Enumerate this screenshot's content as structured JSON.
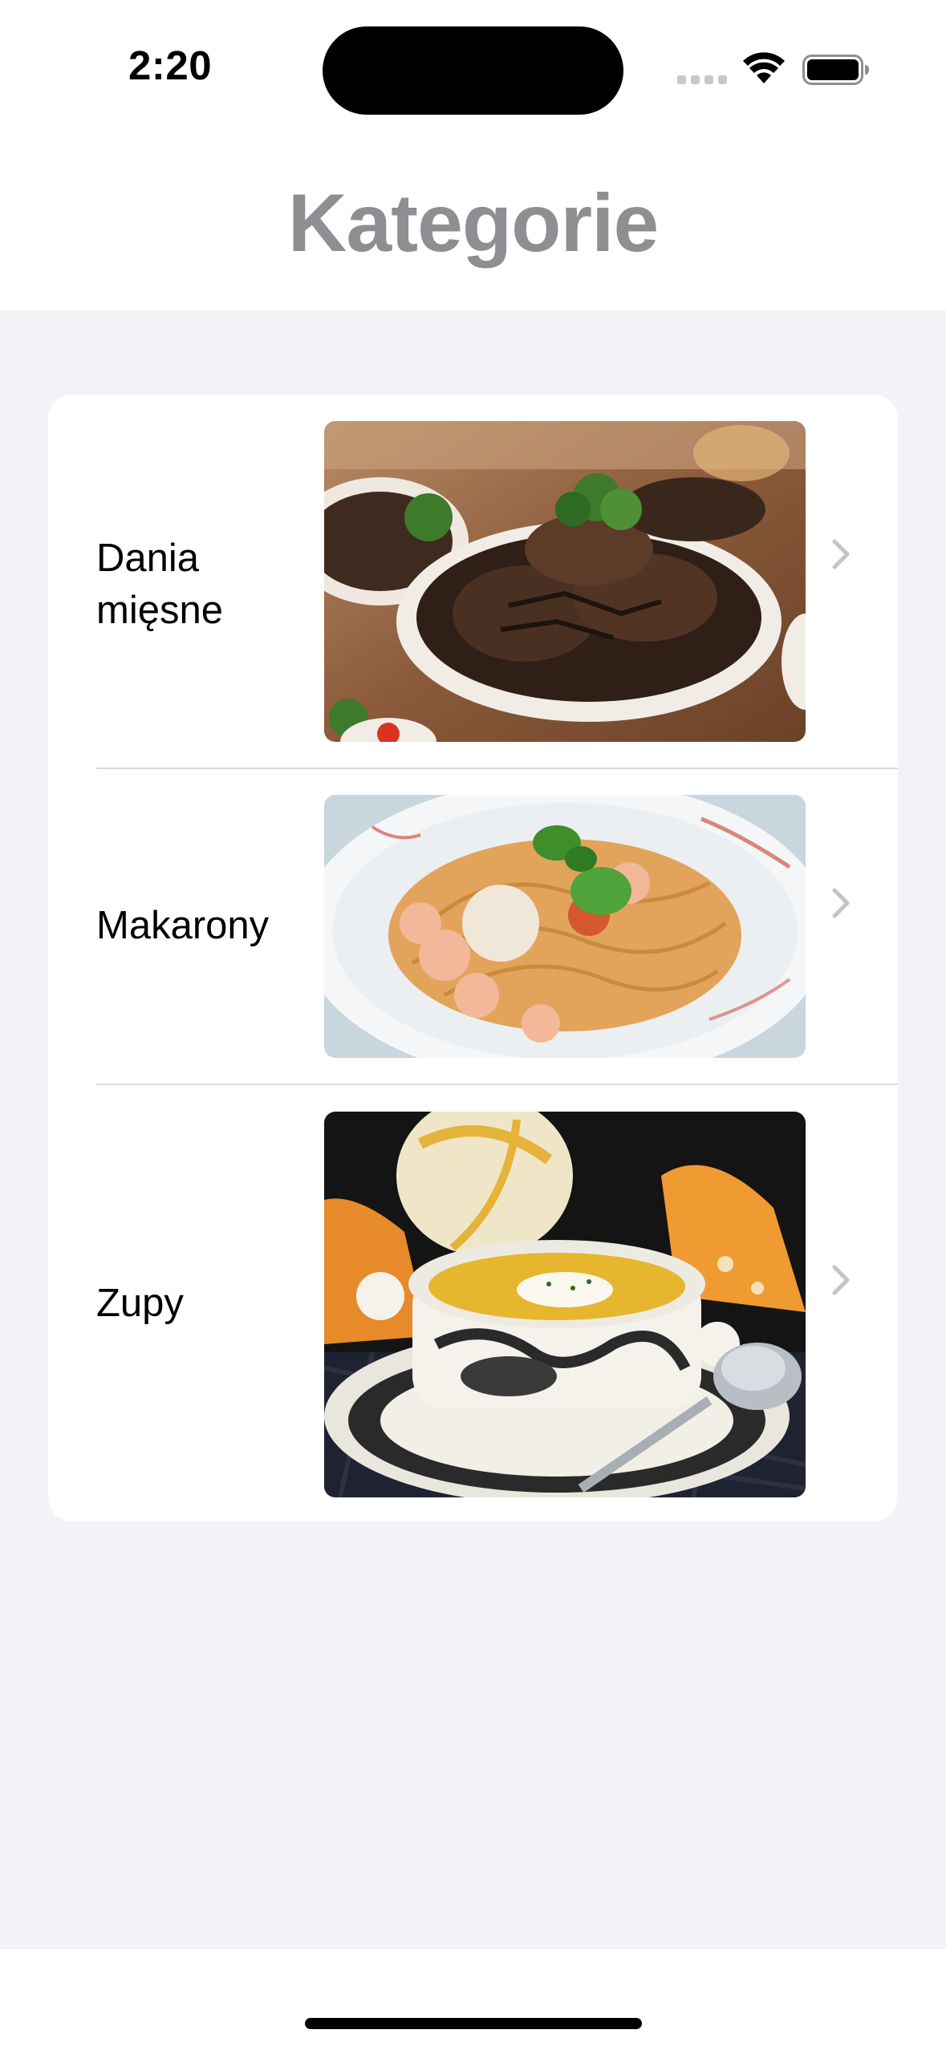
{
  "status_bar": {
    "time": "2:20"
  },
  "nav": {
    "title": "Kategorie"
  },
  "categories": [
    {
      "label": "Dania\nmięsne",
      "image": "grilled-meat-platter-photo"
    },
    {
      "label": "Makarony",
      "image": "shrimp-spaghetti-photo"
    },
    {
      "label": "Zupy",
      "image": "pumpkin-soup-bowl-photo"
    }
  ],
  "colors": {
    "background": "#F2F2F7",
    "title_gray": "#8E8E93",
    "chevron": "#C4C4C7",
    "separator": "#D9D9DE"
  }
}
